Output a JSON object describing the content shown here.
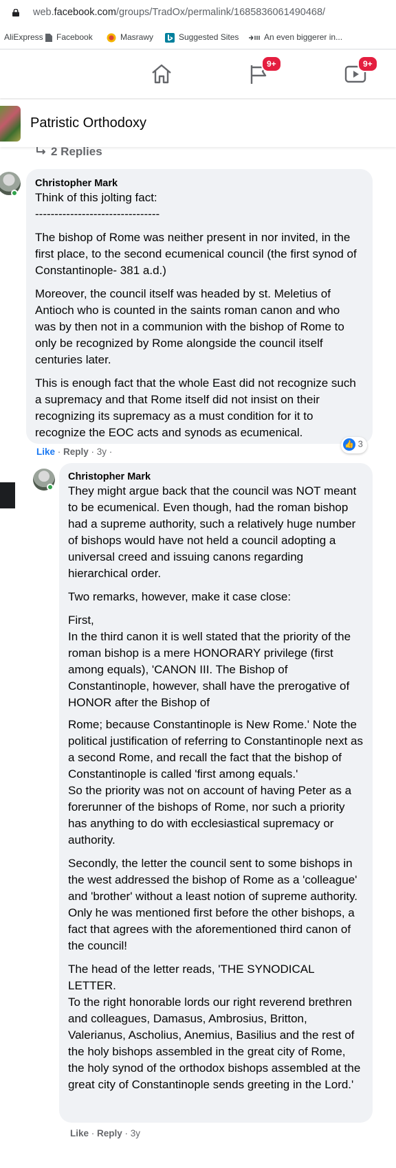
{
  "browser": {
    "url_prefix": "web.",
    "url_host": "facebook.com",
    "url_path": "/groups/TradOx/permalink/1685836061490468/",
    "bookmarks": [
      "AliExpress",
      "Facebook",
      "Masrawy",
      "Suggested Sites",
      "An even biggerer in..."
    ]
  },
  "nav": {
    "groups_badge": "9+",
    "watch_badge": "9+"
  },
  "group": {
    "name": "Patristic Orthodoxy"
  },
  "replies_label": "2 Replies",
  "comment1": {
    "author": "Christopher Mark",
    "p1_l1": "Think of this jolting fact:",
    "p1_l2": "--------------------------------",
    "p2": "The bishop of Rome was neither present in nor invited, in the first place, to the second ecumenical council (the first synod of Constantinople- 381 a.d.)",
    "p3": "Moreover, the council itself was headed by st. Meletius of Antioch who is counted in the saints roman canon and who was by then not in a communion with the bishop of Rome to only be recognized by Rome alongside the council itself centuries later.",
    "p4": "This is enough fact that the whole East did not recognize such a supremacy and that Rome itself did not insist on their recognizing its supremacy as a must condition for it to recognize the EOC acts and synods as ecumenical.",
    "like": "Like",
    "reply": "Reply",
    "age": "3y",
    "reaction_count": "3"
  },
  "comment2": {
    "author": "Christopher Mark",
    "p1": "They might argue back that the council was NOT meant to be ecumenical. Even though, had the roman bishop had a supreme authority, such a relatively huge number of bishops would have not held a council adopting a universal creed and issuing canons regarding hierarchical order.",
    "p2": "Two remarks, however, make it case close:",
    "p3_l1": "First,",
    "p3_l2": "In the third canon it is well stated that the priority of the roman bishop is a mere HONORARY privilege (first among equals), 'CANON III. The Bishop of Constantinople, however, shall have the prerogative of HONOR after the Bishop of",
    "p3_l3": "Rome; because Constantinople is New Rome.' Note the political justification of referring to Constantinople next as a second Rome, and recall the fact that the bishop of Constantinople is called 'first among equals.'",
    "p3_l4": "So the priority was not on account of having Peter as a forerunner of the bishops of Rome, nor such a priority has anything to do with ecclesiastical supremacy or authority.",
    "p4": "Secondly, the letter the council sent to some bishops in the west addressed the bishop of Rome as a 'colleague' and 'brother' without a least notion of supreme authority. Only he was mentioned first before the other bishops, a fact that agrees with the aforementioned third canon of the council!",
    "p5_l1": "The head of the letter reads, 'THE SYNODICAL LETTER.",
    "p5_l2": "To the right honorable lords our right reverend brethren and colleagues, Damasus, Ambrosius, Britton, Valerianus, Ascholius, Anemius, Basilius and the rest of the holy bishops assembled in the great city of Rome, the holy synod of the orthodox bishops assembled at the great city of Constantinople sends greeting in the Lord.'",
    "like": "Like",
    "reply": "Reply",
    "age": "3y"
  }
}
